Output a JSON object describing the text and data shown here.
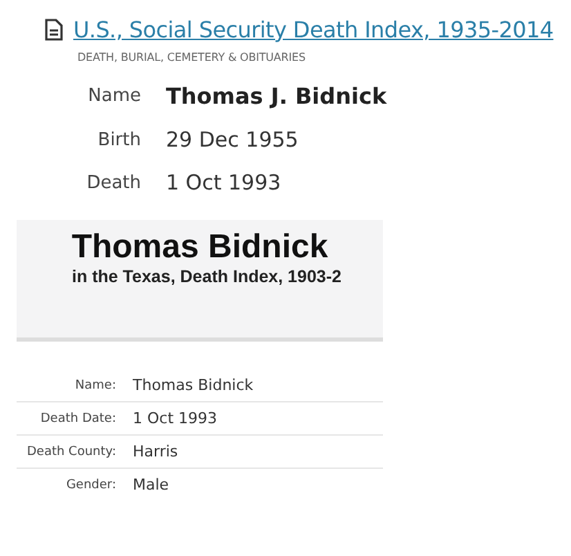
{
  "record": {
    "title": "U.S., Social Security Death Index, 1935-2014",
    "category": "DEATH, BURIAL, CEMETERY & OBITUARIES",
    "fields": [
      {
        "label": "Name",
        "value": "Thomas J. Bidnick",
        "kind": "name"
      },
      {
        "label": "Birth",
        "value": "29 Dec 1955",
        "kind": "plain"
      },
      {
        "label": "Death",
        "value": "1 Oct 1993",
        "kind": "plain"
      }
    ]
  },
  "index_record": {
    "name": "Thomas Bidnick",
    "subtitle": "in the Texas, Death Index, 1903-2",
    "fields": [
      {
        "label": "Name:",
        "value": "Thomas Bidnick"
      },
      {
        "label": "Death Date:",
        "value": "1 Oct 1993"
      },
      {
        "label": "Death County:",
        "value": "Harris"
      },
      {
        "label": "Gender:",
        "value": "Male"
      }
    ]
  }
}
